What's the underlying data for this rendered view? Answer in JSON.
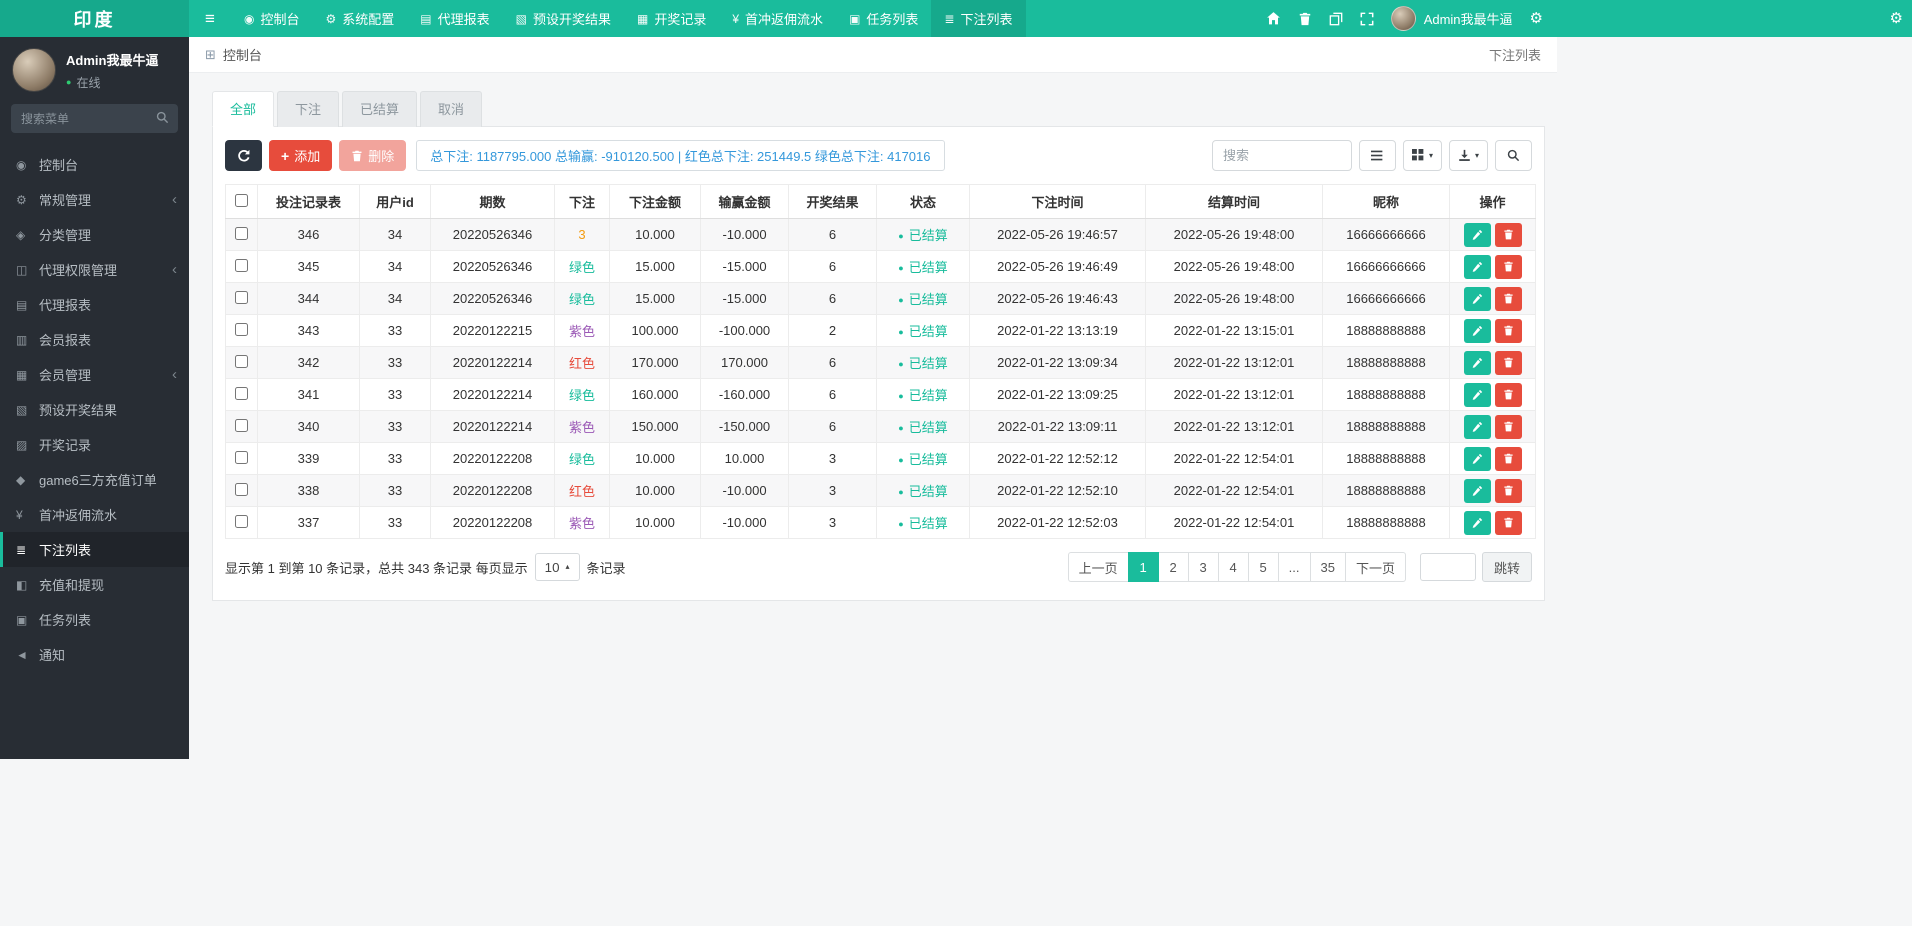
{
  "colors": {
    "accent": "#1abc9c",
    "accent_dark": "#16a98c",
    "danger": "#e74c3c",
    "summary_blue": "#3498db",
    "status_teal": "#18bc9c"
  },
  "navbar": {
    "brand": "印度",
    "items": [
      {
        "label": "控制台",
        "icon": "dashboard-icon"
      },
      {
        "label": "系统配置",
        "icon": "system-config-icon"
      },
      {
        "label": "代理报表",
        "icon": "agent-report-icon"
      },
      {
        "label": "预设开奖结果",
        "icon": "preset-results-icon"
      },
      {
        "label": "开奖记录",
        "icon": "draw-records-icon"
      },
      {
        "label": "首冲返佣流水",
        "icon": "rebate-icon"
      },
      {
        "label": "任务列表",
        "icon": "task-list-icon"
      },
      {
        "label": "下注列表",
        "icon": "bet-list-icon",
        "active": true
      }
    ],
    "username": "Admin我最牛逼"
  },
  "sidebar": {
    "user": {
      "name": "Admin我最牛逼",
      "status": "在线"
    },
    "search_placeholder": "搜索菜单",
    "items": [
      {
        "label": "控制台"
      },
      {
        "label": "常规管理",
        "expandable": true
      },
      {
        "label": "分类管理"
      },
      {
        "label": "代理权限管理",
        "expandable": true
      },
      {
        "label": "代理报表"
      },
      {
        "label": "会员报表"
      },
      {
        "label": "会员管理",
        "expandable": true
      },
      {
        "label": "预设开奖结果"
      },
      {
        "label": "开奖记录"
      },
      {
        "label": "game6三方充值订单"
      },
      {
        "label": "首冲返佣流水"
      },
      {
        "label": "下注列表",
        "active": true
      },
      {
        "label": "充值和提现"
      },
      {
        "label": "任务列表"
      },
      {
        "label": "通知"
      }
    ]
  },
  "breadcrumb": {
    "section": "控制台",
    "current": "下注列表"
  },
  "tabs": [
    {
      "label": "全部",
      "active": true
    },
    {
      "label": "下注"
    },
    {
      "label": "已结算"
    },
    {
      "label": "取消"
    }
  ],
  "toolbar": {
    "add": "添加",
    "delete": "删除",
    "summary": "总下注: 1187795.000 总输赢: -910120.500 | 红色总下注: 251449.5 绿色总下注: 417016",
    "search_placeholder": "搜索"
  },
  "table": {
    "columns": [
      "投注记录表",
      "用户id",
      "期数",
      "下注",
      "下注金额",
      "输赢金额",
      "开奖结果",
      "状态",
      "下注时间",
      "结算时间",
      "昵称",
      "操作"
    ],
    "rows": [
      {
        "id": "346",
        "uid": "34",
        "period": "20220526346",
        "bet": "3",
        "bet_color": "#f39c12",
        "amount": "10.000",
        "win": "-10.000",
        "result": "6",
        "status": "已结算",
        "bet_time": "2022-05-26 19:46:57",
        "settle_time": "2022-05-26 19:48:00",
        "nick": "16666666666"
      },
      {
        "id": "345",
        "uid": "34",
        "period": "20220526346",
        "bet": "绿色",
        "bet_color": "#18bc9c",
        "amount": "15.000",
        "win": "-15.000",
        "result": "6",
        "status": "已结算",
        "bet_time": "2022-05-26 19:46:49",
        "settle_time": "2022-05-26 19:48:00",
        "nick": "16666666666"
      },
      {
        "id": "344",
        "uid": "34",
        "period": "20220526346",
        "bet": "绿色",
        "bet_color": "#18bc9c",
        "amount": "15.000",
        "win": "-15.000",
        "result": "6",
        "status": "已结算",
        "bet_time": "2022-05-26 19:46:43",
        "settle_time": "2022-05-26 19:48:00",
        "nick": "16666666666"
      },
      {
        "id": "343",
        "uid": "33",
        "period": "20220122215",
        "bet": "紫色",
        "bet_color": "#9b59b6",
        "amount": "100.000",
        "win": "-100.000",
        "result": "2",
        "status": "已结算",
        "bet_time": "2022-01-22 13:13:19",
        "settle_time": "2022-01-22 13:15:01",
        "nick": "18888888888"
      },
      {
        "id": "342",
        "uid": "33",
        "period": "20220122214",
        "bet": "红色",
        "bet_color": "#e74c3c",
        "amount": "170.000",
        "win": "170.000",
        "result": "6",
        "status": "已结算",
        "bet_time": "2022-01-22 13:09:34",
        "settle_time": "2022-01-22 13:12:01",
        "nick": "18888888888"
      },
      {
        "id": "341",
        "uid": "33",
        "period": "20220122214",
        "bet": "绿色",
        "bet_color": "#18bc9c",
        "amount": "160.000",
        "win": "-160.000",
        "result": "6",
        "status": "已结算",
        "bet_time": "2022-01-22 13:09:25",
        "settle_time": "2022-01-22 13:12:01",
        "nick": "18888888888"
      },
      {
        "id": "340",
        "uid": "33",
        "period": "20220122214",
        "bet": "紫色",
        "bet_color": "#9b59b6",
        "amount": "150.000",
        "win": "-150.000",
        "result": "6",
        "status": "已结算",
        "bet_time": "2022-01-22 13:09:11",
        "settle_time": "2022-01-22 13:12:01",
        "nick": "18888888888"
      },
      {
        "id": "339",
        "uid": "33",
        "period": "20220122208",
        "bet": "绿色",
        "bet_color": "#18bc9c",
        "amount": "10.000",
        "win": "10.000",
        "result": "3",
        "status": "已结算",
        "bet_time": "2022-01-22 12:52:12",
        "settle_time": "2022-01-22 12:54:01",
        "nick": "18888888888"
      },
      {
        "id": "338",
        "uid": "33",
        "period": "20220122208",
        "bet": "红色",
        "bet_color": "#e74c3c",
        "amount": "10.000",
        "win": "-10.000",
        "result": "3",
        "status": "已结算",
        "bet_time": "2022-01-22 12:52:10",
        "settle_time": "2022-01-22 12:54:01",
        "nick": "18888888888"
      },
      {
        "id": "337",
        "uid": "33",
        "period": "20220122208",
        "bet": "紫色",
        "bet_color": "#9b59b6",
        "amount": "10.000",
        "win": "-10.000",
        "result": "3",
        "status": "已结算",
        "bet_time": "2022-01-22 12:52:03",
        "settle_time": "2022-01-22 12:54:01",
        "nick": "18888888888"
      }
    ]
  },
  "footer": {
    "info_before": "显示第 1 到第 10 条记录，总共 343 条记录 每页显示",
    "page_size": "10",
    "info_after": "条记录",
    "prev": "上一页",
    "pages": [
      "1",
      "2",
      "3",
      "4",
      "5",
      "...",
      "35"
    ],
    "next": "下一页",
    "jump": "跳转"
  }
}
